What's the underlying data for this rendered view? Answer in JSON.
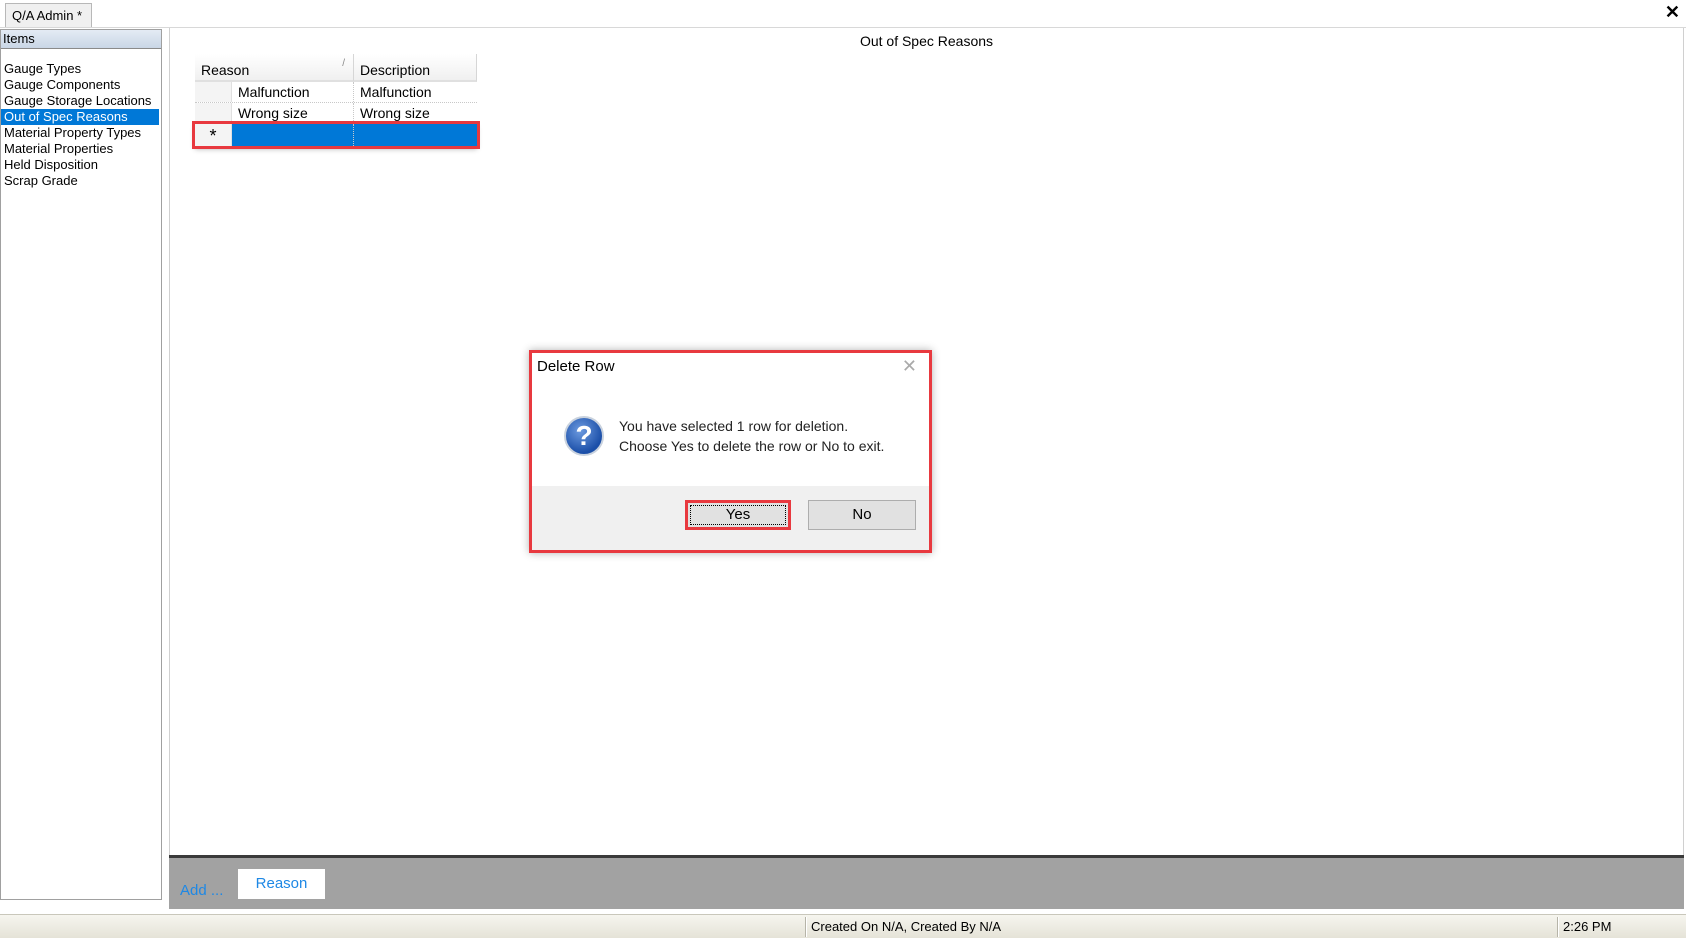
{
  "window": {
    "tab_label": "Q/A Admin *",
    "close_icon": "close-icon"
  },
  "sidebar": {
    "header": "Items",
    "items": [
      {
        "label": "Gauge Types"
      },
      {
        "label": "Gauge Components"
      },
      {
        "label": "Gauge Storage Locations"
      },
      {
        "label": "Out of Spec Reasons",
        "selected": true
      },
      {
        "label": "Material Property Types"
      },
      {
        "label": "Material Properties"
      },
      {
        "label": "Held Disposition"
      },
      {
        "label": "Scrap Grade"
      }
    ]
  },
  "main": {
    "title": "Out of Spec Reasons",
    "grid": {
      "columns": [
        "Reason",
        "Description"
      ],
      "rows": [
        {
          "reason": "Malfunction",
          "description": "Malfunction"
        },
        {
          "reason": "Wrong size",
          "description": "Wrong size"
        }
      ],
      "new_row_marker": "*"
    }
  },
  "dialog": {
    "title": "Delete Row",
    "message_line1": "You have selected 1 row for deletion.",
    "message_line2": "Choose Yes to delete the row or No to exit.",
    "icon": "question-icon",
    "icon_glyph": "?",
    "yes_label": "Yes",
    "no_label": "No"
  },
  "bottom_bar": {
    "add_label": "Add ...",
    "reason_button": "Reason"
  },
  "status_bar": {
    "created": "Created On N/A, Created By N/A",
    "time": "2:26 PM"
  },
  "colors": {
    "selection": "#0078d7",
    "highlight": "#e8393f",
    "link": "#1e88e5"
  }
}
